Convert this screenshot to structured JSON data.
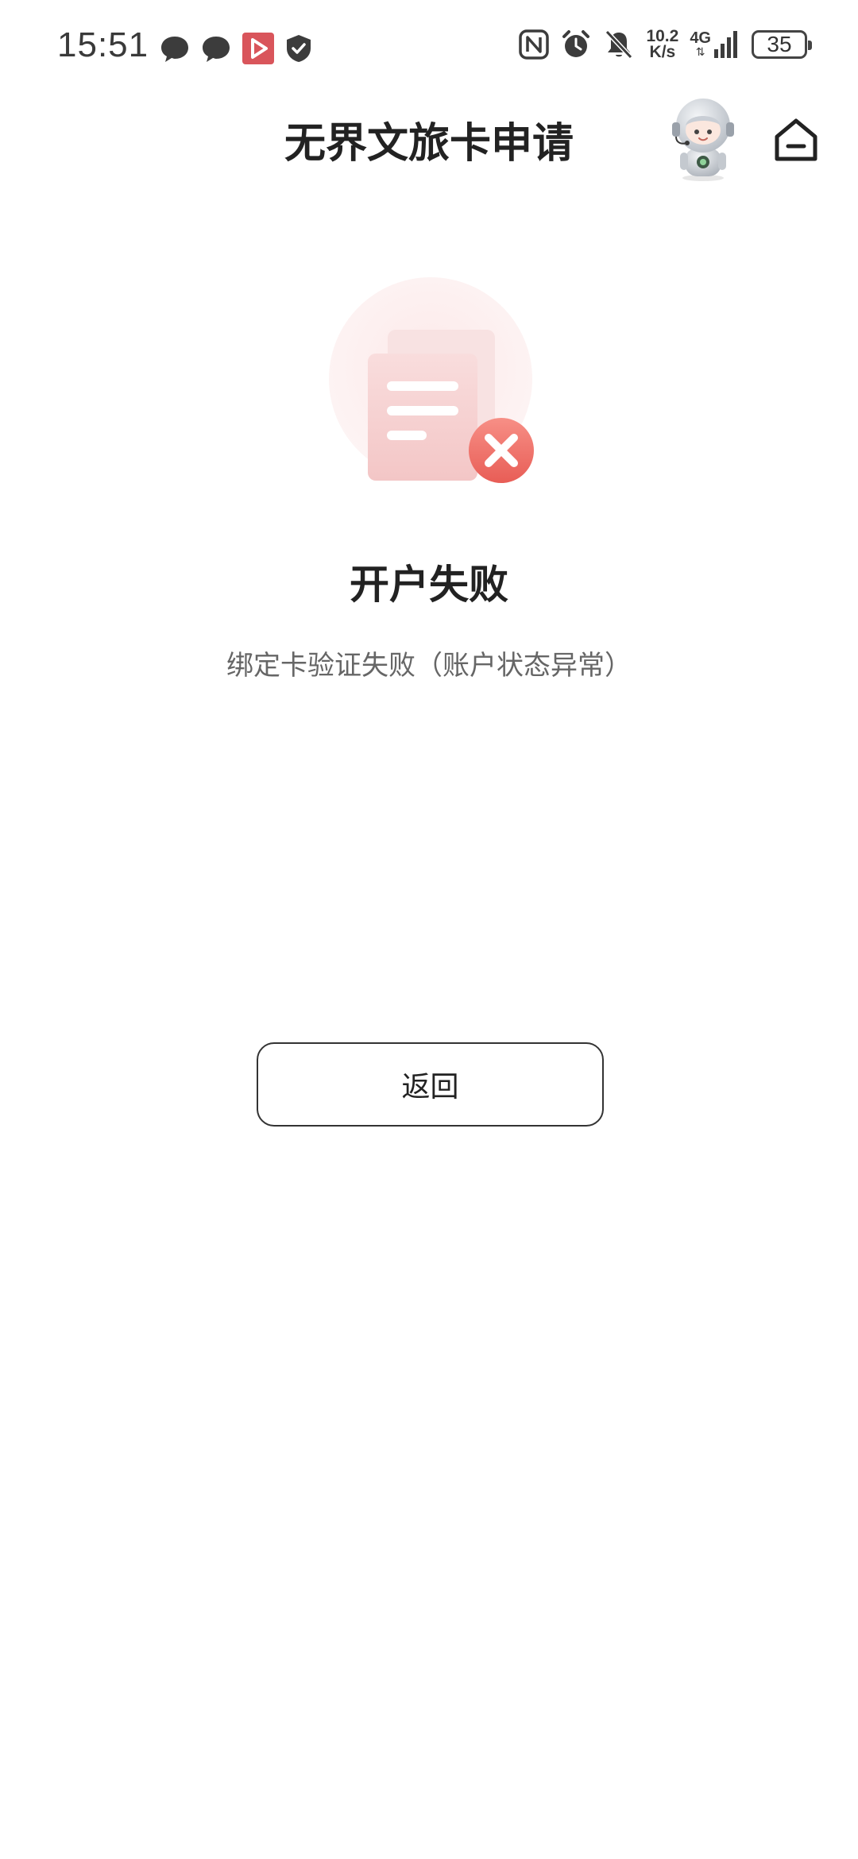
{
  "status_bar": {
    "time": "15:51",
    "net_speed_value": "10.2",
    "net_speed_unit": "K/s",
    "network_type": "4G",
    "battery": "35",
    "left_icons": [
      "chat-bubble-icon",
      "chat-bubble-icon",
      "video-app-icon",
      "shield-check-icon"
    ],
    "right_icons": [
      "nfc-icon",
      "alarm-icon",
      "bell-muted-icon",
      "signal-icon"
    ]
  },
  "header": {
    "title": "无界文旅卡申请",
    "icons": [
      "robot-assistant-icon",
      "home-icon"
    ]
  },
  "result": {
    "title": "开户失败",
    "message": "绑定卡验证失败（账户状态异常）",
    "icon": "document-failed-icon",
    "accent_color": "#ee6a63"
  },
  "actions": {
    "back_label": "返回"
  }
}
